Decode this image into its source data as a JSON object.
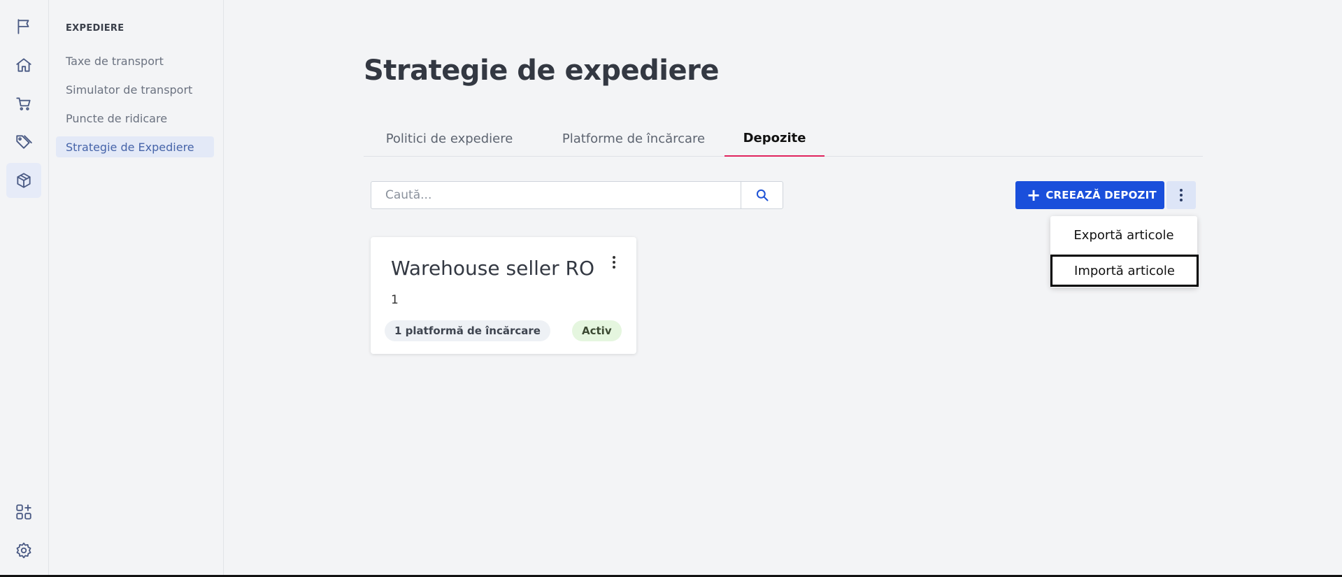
{
  "rail": {
    "icons": [
      "flag-icon",
      "home-icon",
      "cart-icon",
      "tags-icon",
      "package-icon",
      "apps-add-icon",
      "gear-icon"
    ]
  },
  "subnav": {
    "heading": "EXPEDIERE",
    "items": [
      {
        "label": "Taxe de transport"
      },
      {
        "label": "Simulator de transport"
      },
      {
        "label": "Puncte de ridicare"
      },
      {
        "label": "Strategie de Expediere"
      }
    ]
  },
  "page": {
    "title": "Strategie de expediere"
  },
  "tabs": [
    {
      "label": "Politici de expediere"
    },
    {
      "label": "Platforme de încărcare"
    },
    {
      "label": "Depozite"
    }
  ],
  "search": {
    "placeholder": "Caută..."
  },
  "toolbar": {
    "create_label": "CREEAZĂ DEPOZIT"
  },
  "menu": {
    "items": [
      {
        "label": "Exportă articole"
      },
      {
        "label": "Importă articole"
      }
    ]
  },
  "warehouses": [
    {
      "name": "Warehouse seller RO",
      "count": "1",
      "platforms": "1 platformă de încărcare",
      "status": "Activ"
    }
  ],
  "colors": {
    "accent": "#1a4fdb",
    "tab_underline": "#e0245e",
    "status_bg": "#e5f6df"
  }
}
